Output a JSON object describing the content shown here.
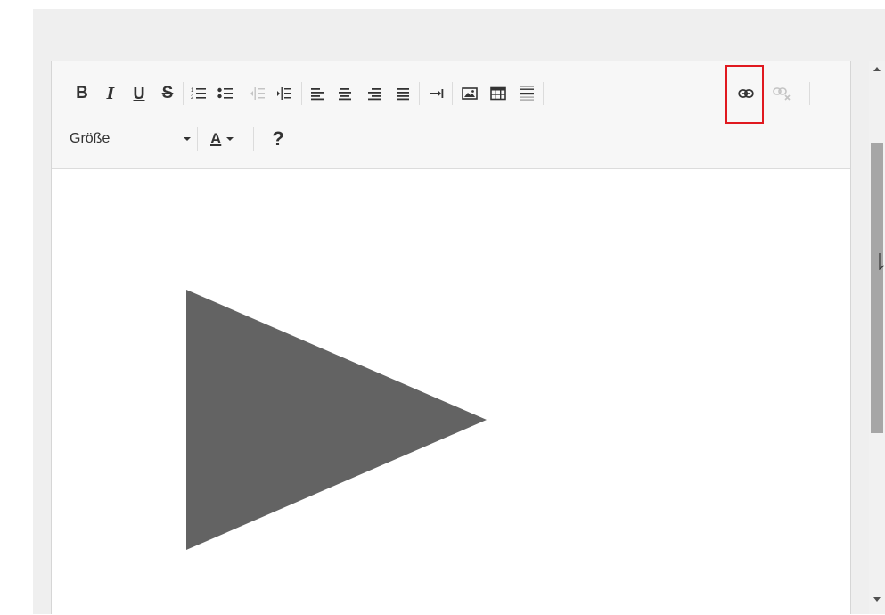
{
  "toolbar": {
    "bold_label": "B",
    "italic_label": "I",
    "underline_label": "U",
    "strike_label": "S",
    "size_label": "Größe",
    "color_label": "A",
    "help_label": "?",
    "icons": [
      "bold-icon",
      "italic-icon",
      "underline-icon",
      "strikethrough-icon",
      "ordered-list-icon",
      "unordered-list-icon",
      "outdent-icon",
      "indent-icon",
      "align-left-icon",
      "align-center-icon",
      "align-right-icon",
      "align-justify-icon",
      "tab-icon",
      "image-icon",
      "table-icon",
      "horizontal-rule-icon",
      "link-icon",
      "unlink-icon",
      "help-icon"
    ],
    "highlighted_button": "link-button",
    "highlight_color": "#e0191f"
  },
  "content": {
    "shape": "play-triangle",
    "shape_color": "#636363"
  },
  "colors": {
    "background": "#efefef",
    "toolbar_bg": "#f7f7f7",
    "icon": "#333333",
    "icon_disabled": "#c4c4c4",
    "scroll_thumb": "#a6a6a6"
  }
}
